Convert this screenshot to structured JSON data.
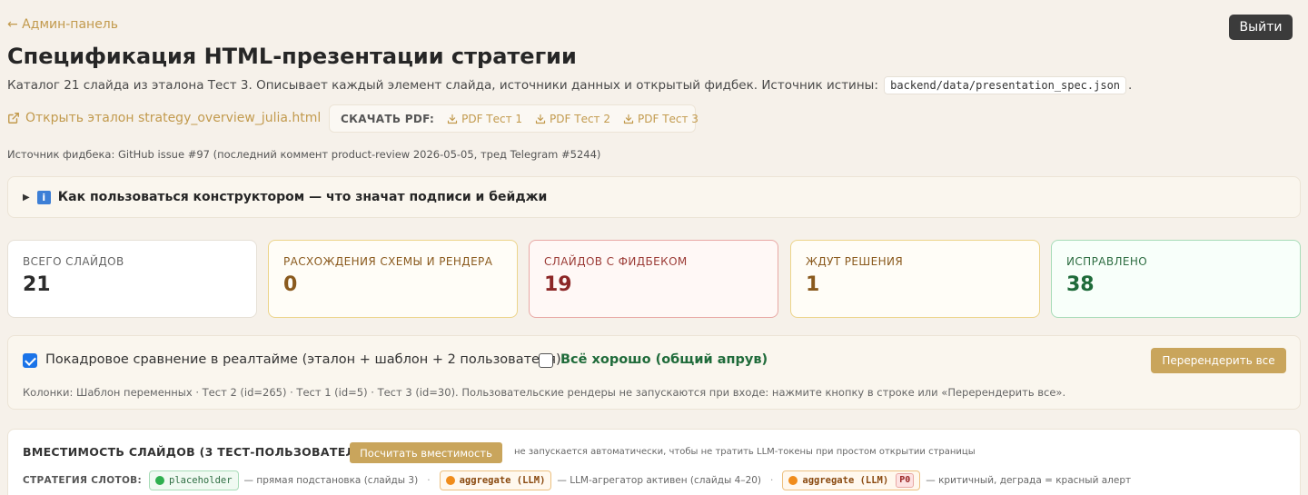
{
  "header": {
    "back_link": "← Админ-панель",
    "logout_label": "Выйти",
    "title": "Спецификация HTML-презентации стратегии",
    "description_prefix": "Каталог 21 слайда из эталона Тест 3. Описывает каждый элемент слайда, источники данных и открытый фидбек. Источник истины:",
    "source_file": "backend/data/presentation_spec.json",
    "description_suffix": "."
  },
  "links": {
    "open_reference": "Открыть эталон strategy_overview_julia.html",
    "download_label": "СКАЧАТЬ PDF:",
    "pdfs": [
      "PDF Тест 1",
      "PDF Тест 2",
      "PDF Тест 3"
    ]
  },
  "feedback_source": "Источник фидбека: GitHub issue #97 (последний коммент product-review 2026-05-05, тред Telegram #5244)",
  "howto": {
    "text": "Как пользоваться конструктором — что значат подписи и бейджи"
  },
  "stats": [
    {
      "label": "ВСЕГО СЛАЙДОВ",
      "value": "21"
    },
    {
      "label": "РАСХОЖДЕНИЯ СХЕМЫ И РЕНДЕРА",
      "value": "0"
    },
    {
      "label": "СЛАЙДОВ С ФИДБЕКОМ",
      "value": "19"
    },
    {
      "label": "ЖДУТ РЕШЕНИЯ",
      "value": "1"
    },
    {
      "label": "ИСПРАВЛЕНО",
      "value": "38"
    }
  ],
  "compare": {
    "realtime_label": "Покадровое сравнение в реалтайме (эталон + шаблон + 2 пользователя)",
    "realtime_checked": true,
    "approve_label": "Всё хорошо (общий апрув)",
    "approve_checked": false,
    "rerender_label": "Перерендерить все",
    "columns_note": "Колонки: Шаблон переменных · Тест 2 (id=265) · Тест 1 (id=5) · Тест 3 (id=30). Пользовательские рендеры не запускаются при входе: нажмите кнопку в строке или «Перерендерить все»."
  },
  "capacity": {
    "title": "ВМЕСТИМОСТЬ СЛАЙДОВ (3 ТЕСТ-ПОЛЬЗОВАТЕЛЯ)",
    "button_label": "Посчитать вместимость",
    "note": "не запускается автоматически, чтобы не тратить LLM-токены при простом открытии страницы",
    "slots_label": "СТРАТЕГИЯ СЛОТОВ:",
    "slots": [
      {
        "chip": "placeholder",
        "desc": "— прямая подстановка (слайды 3)"
      },
      {
        "chip": "aggregate (LLM)",
        "desc": "— LLM-агрегатор активен (слайды 4–20)"
      },
      {
        "chip": "aggregate (LLM)",
        "badge": "P0",
        "desc": "— критичный, деграда = красный алерт"
      }
    ],
    "separator": "·"
  },
  "colors": {
    "accent": "#c29a4d",
    "button_gold": "#c9a55c",
    "background": "#f6f1ea",
    "danger": "#8c2626",
    "success": "#1f6b3a"
  }
}
